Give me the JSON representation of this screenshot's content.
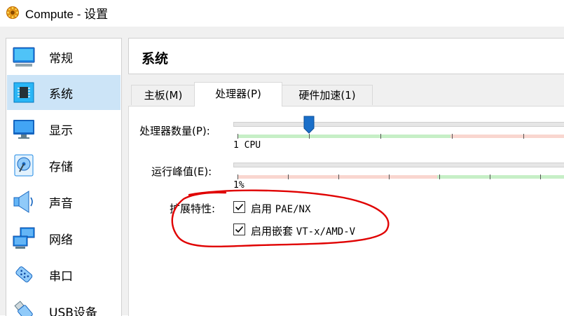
{
  "window": {
    "app": "Compute",
    "separator": " - ",
    "section": "设置"
  },
  "sidebar": {
    "items": [
      {
        "label": "常规",
        "icon": "monitor-general-icon",
        "selected": false
      },
      {
        "label": "系统",
        "icon": "chip-icon",
        "selected": true
      },
      {
        "label": "显示",
        "icon": "display-icon",
        "selected": false
      },
      {
        "label": "存储",
        "icon": "storage-disk-icon",
        "selected": false
      },
      {
        "label": "声音",
        "icon": "speaker-icon",
        "selected": false
      },
      {
        "label": "网络",
        "icon": "network-icon",
        "selected": false
      },
      {
        "label": "串口",
        "icon": "serial-port-icon",
        "selected": false
      },
      {
        "label": "USB设备",
        "icon": "usb-icon",
        "selected": false
      }
    ]
  },
  "page_title": "系统",
  "tabs": [
    {
      "label": "主板(M)",
      "active": false
    },
    {
      "label": "处理器(P)",
      "active": true
    },
    {
      "label": "硬件加速(1)",
      "active": false
    }
  ],
  "processor": {
    "count_label": "处理器数量(P):",
    "count_value": 2,
    "count_min_label": "1 CPU",
    "exec_cap_label": "运行峰值(E):",
    "exec_cap_min_label": "1%",
    "features_label": "扩展特性:",
    "features": [
      {
        "label": "启用",
        "code": "PAE/NX",
        "checked": true
      },
      {
        "label": "启用嵌套",
        "code": "VT-x/AMD-V",
        "checked": true
      }
    ]
  },
  "colors": {
    "selected_bg": "#cce4f7",
    "slider_thumb": "#1a6fc9",
    "scale_green": "#c6efc6",
    "scale_red": "#f9d6cf",
    "annotation_red": "#e00000"
  }
}
